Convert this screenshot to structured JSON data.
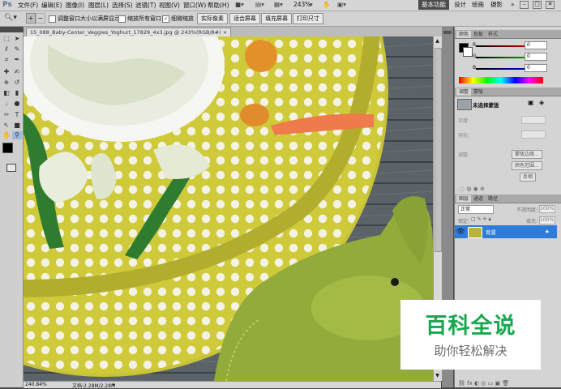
{
  "app": {
    "logo": "Ps"
  },
  "menubar": {
    "items": [
      "文件(F)",
      "编辑(E)",
      "图像(I)",
      "图层(L)",
      "选择(S)",
      "滤镜(T)",
      "视图(V)",
      "窗口(W)",
      "帮助(H)"
    ],
    "zoom": "243%",
    "workspaces": [
      "基本功能",
      "设计",
      "绘画",
      "摄影"
    ],
    "more": "»"
  },
  "options": {
    "checks": [
      {
        "label": "调整窗口大小以满屏显示",
        "checked": false
      },
      {
        "label": "缩放所有窗口",
        "checked": false
      },
      {
        "label": "细微缩放",
        "checked": true
      }
    ],
    "buttons": [
      "实际像素",
      "适合屏幕",
      "填充屏幕",
      "打印尺寸"
    ]
  },
  "document": {
    "tab": "15_088_Baby-Center_Veggies_Yoghurt_17829_4x3.jpg @ 243%(RGB/8#)",
    "close": "×"
  },
  "status": {
    "zoom": "240.84%",
    "doc": "文档:2.28M/2.28M"
  },
  "color_panel": {
    "tabs": [
      "颜色",
      "色板",
      "样式"
    ],
    "r": "0",
    "g": "0",
    "b": "0"
  },
  "adjust_panel": {
    "tabs": [
      "调整",
      "蒙版"
    ],
    "title": "未选择蒙版",
    "density": "浓度:",
    "feather": "羽化:",
    "refine": "调整:",
    "buttons": [
      "蒙版边缘...",
      "颜色范围...",
      "反相"
    ]
  },
  "layers_panel": {
    "tabs": [
      "图层",
      "通道",
      "路径"
    ],
    "blend": "正常",
    "opacity_label": "不透明度:",
    "opacity": "100%",
    "lock_label": "锁定:",
    "fill_label": "填充:",
    "fill": "100%",
    "layer_name": "背景"
  },
  "watermark": {
    "line1": "百科全说",
    "line2": "助你轻松解决"
  },
  "colors": {
    "accent": "#2f7bd6",
    "watermark_green": "#18a84f"
  }
}
